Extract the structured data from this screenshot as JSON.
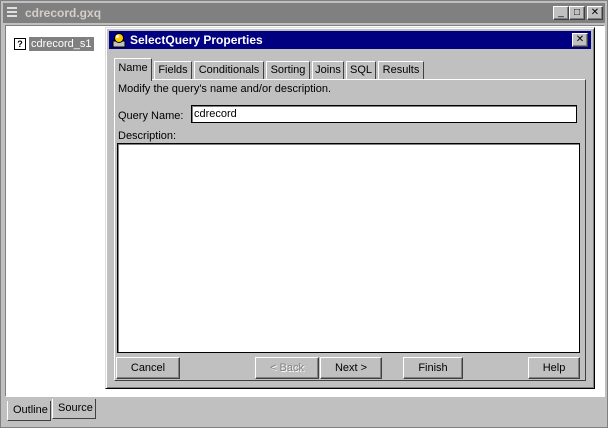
{
  "outer_window": {
    "title": "cdrecord.gxq",
    "min_glyph": "_",
    "max_glyph": "□",
    "close_glyph": "✕",
    "tree_item": {
      "icon_glyph": "?",
      "label": "cdrecord_s1"
    }
  },
  "bottom_tabs": [
    {
      "label": "Outline"
    },
    {
      "label": "Source"
    }
  ],
  "dialog": {
    "title": "SelectQuery Properties",
    "close_glyph": "✕",
    "tabs": [
      {
        "label": "Name"
      },
      {
        "label": "Fields"
      },
      {
        "label": "Conditionals"
      },
      {
        "label": "Sorting"
      },
      {
        "label": "Joins"
      },
      {
        "label": "SQL"
      },
      {
        "label": "Results"
      }
    ],
    "active_tab": "Name",
    "instruction": "Modify the query's name and/or description.",
    "query_name_label": "Query Name:",
    "query_name_value": "cdrecord",
    "description_label": "Description:",
    "description_value": "",
    "buttons": {
      "cancel": "Cancel",
      "back": "< Back",
      "next": "Next >",
      "finish": "Finish",
      "help": "Help"
    }
  },
  "colors": {
    "dialog_titlebar": "#000080",
    "outer_titlebar_inactive": "#808080",
    "face": "#c0c0c0"
  }
}
